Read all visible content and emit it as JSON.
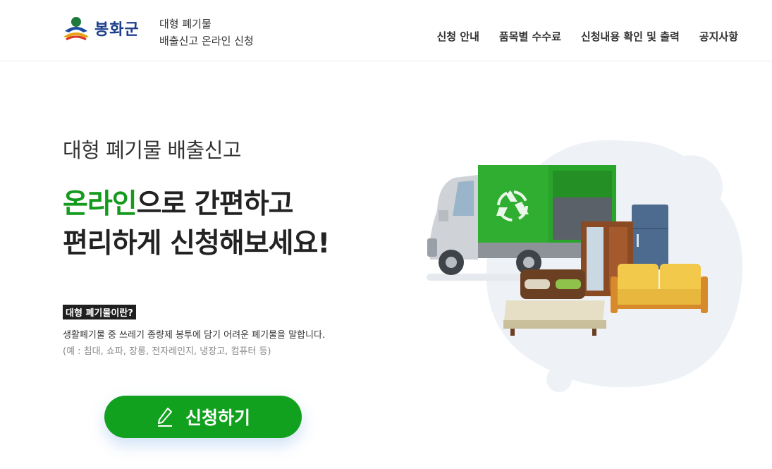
{
  "header": {
    "logo_text": "봉화군",
    "site_title_line1": "대형 폐기물",
    "site_title_line2": "배출신고 온라인 신청",
    "nav": [
      {
        "label": "신청 안내"
      },
      {
        "label": "품목별 수수료"
      },
      {
        "label": "신청내용 확인 및 출력"
      },
      {
        "label": "공지사항"
      }
    ]
  },
  "hero": {
    "subtitle": "대형 폐기물 배출신고",
    "title_accent": "온라인",
    "title_line1_rest": "으로 간편하고",
    "title_line2": "편리하게 신청해보세요!",
    "what_label": "대형 폐기물이란?",
    "description": "생활폐기물 중 쓰레기 종량제 봉투에 담기 어려운 폐기물을 말합니다.",
    "example": "(예 : 침대, 쇼파, 장롱, 전자레인지, 냉장고, 컴퓨터 등)",
    "apply_label": "신청하기"
  },
  "colors": {
    "accent_green": "#149a1c",
    "button_green": "#12a11e",
    "truck_green": "#2aa52b",
    "blob": "#eef2f7"
  },
  "icons": {
    "logo": "county-logo-icon",
    "pencil": "pencil-icon",
    "recycle": "recycle-icon"
  }
}
